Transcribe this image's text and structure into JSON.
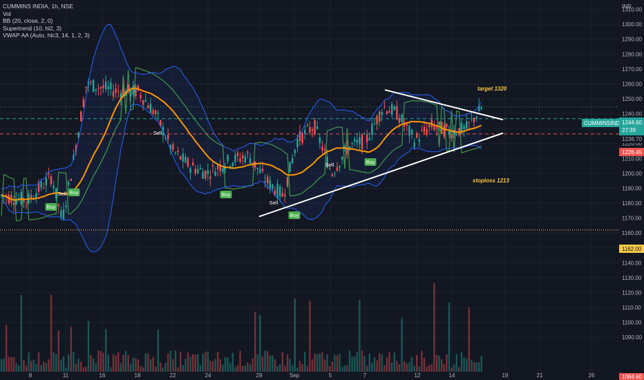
{
  "legend": {
    "symbol": "CUMMINS INDIA, 1h, NSE",
    "vol": "Vol",
    "bb": "BB (20, close, 2, 0)",
    "supertrend": "Supertrend (10, hl2, 3)",
    "vwap": "VWAP AA (Auto, hlc3, 14, 1, 2, 3)"
  },
  "currency": "INR",
  "annotations": {
    "target": "target 1320",
    "stoploss": "stoploss 1213"
  },
  "price_badges": {
    "symbol_tag": "CUMMINSIND",
    "last_price": "1244.60",
    "countdown": "27:39",
    "green_level": "1236.70",
    "red_level": "1226.45",
    "dotted_level": "1162.00",
    "bottom_cut": "1084.60"
  },
  "colors": {
    "background": "#131722",
    "up": "#26a69a",
    "down": "#ef5350",
    "bb_band": "#2962ff",
    "bb_basis": "#ff9800",
    "supertrend_up": "#4caf50",
    "supertrend_down": "#f44336",
    "trendline": "#ffffff",
    "dotted_level": "#f7c948"
  },
  "chart_data": {
    "type": "candlestick",
    "y_axis_ticks": [
      "1310.00",
      "1300.00",
      "1290.00",
      "1280.00",
      "1270.00",
      "1260.00",
      "1250.00",
      "1240.00",
      "1230.00",
      "1220.00",
      "1210.00",
      "1200.00",
      "1190.00",
      "1180.00",
      "1170.00",
      "1160.00",
      "1150.00",
      "1140.00",
      "1130.00",
      "1120.00",
      "1110.00",
      "1100.00",
      "1090.00"
    ],
    "x_axis_ticks": [
      "8",
      "11",
      "16",
      "18",
      "22",
      "24",
      "29",
      "Sep",
      "5",
      "7",
      "12",
      "14",
      "19",
      "21",
      "26"
    ],
    "ylim": [
      1084.6,
      1316
    ],
    "key_levels": {
      "last_price": 1244.6,
      "green_dashed": 1236.7,
      "red_dashed": 1226.45,
      "dotted_support": 1162.0,
      "target": 1320,
      "stoploss": 1213
    },
    "triangle_upper": [
      [
        "Sep 7",
        1256
      ],
      [
        "Sep 18",
        1236
      ]
    ],
    "triangle_lower": [
      [
        "Aug 29",
        1171
      ],
      [
        "Sep 18",
        1227
      ]
    ],
    "signals": [
      {
        "label": "Buy",
        "date": "Aug 8"
      },
      {
        "label": "Sell",
        "date": "Aug 10"
      },
      {
        "label": "Buy",
        "date": "Aug 11"
      },
      {
        "label": "Sell",
        "date": "Aug 19"
      },
      {
        "label": "Buy",
        "date": "Aug 25"
      },
      {
        "label": "Sell",
        "date": "Aug 29"
      },
      {
        "label": "Buy",
        "date": "Aug 31"
      },
      {
        "label": "Sell",
        "date": "Sep 4"
      },
      {
        "label": "Buy",
        "date": "Sep 6"
      }
    ]
  }
}
